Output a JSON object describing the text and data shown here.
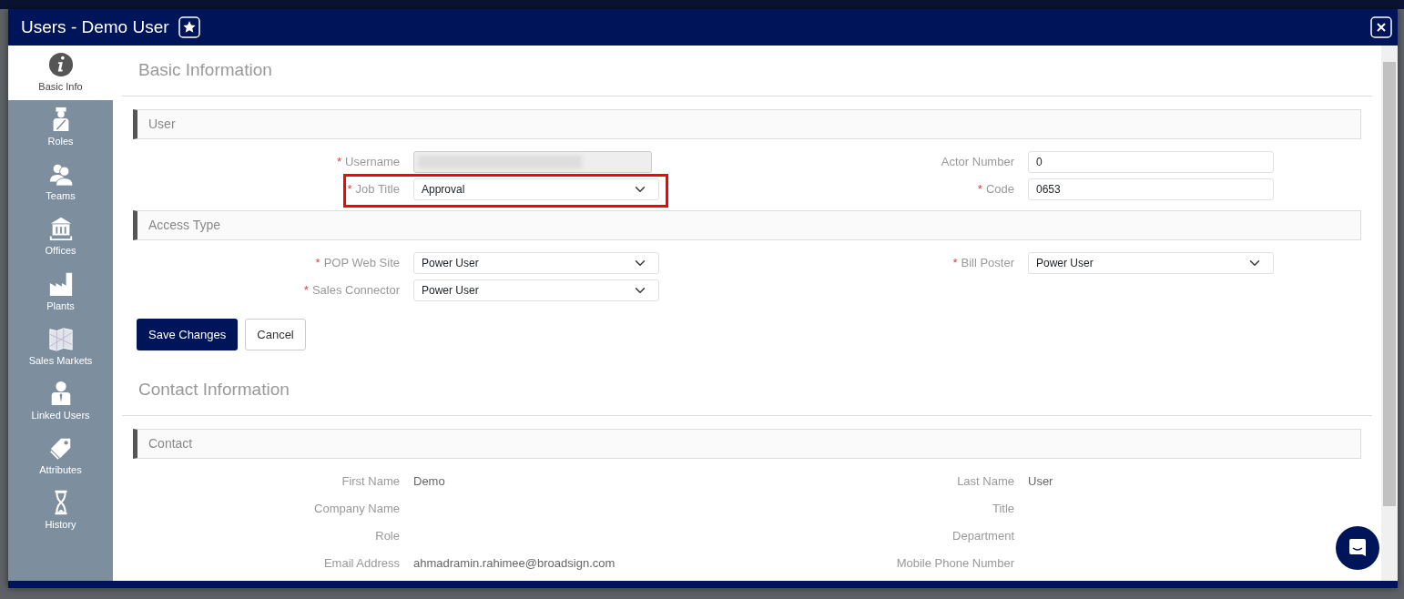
{
  "window": {
    "title": "Users - Demo User"
  },
  "sidebar": {
    "items": [
      {
        "label": "Basic Info",
        "selected": true
      },
      {
        "label": "Roles",
        "selected": false
      },
      {
        "label": "Teams",
        "selected": false
      },
      {
        "label": "Offices",
        "selected": false
      },
      {
        "label": "Plants",
        "selected": false
      },
      {
        "label": "Sales Markets",
        "selected": false
      },
      {
        "label": "Linked Users",
        "selected": false
      },
      {
        "label": "Attributes",
        "selected": false
      },
      {
        "label": "History",
        "selected": false
      }
    ]
  },
  "sections": [
    {
      "heading": "Basic Information",
      "groups": [
        {
          "title": "User",
          "left": [
            {
              "label": "Username",
              "marker": "*",
              "kind": "blurred"
            },
            {
              "label": "Job Title",
              "marker": "*",
              "kind": "select",
              "value": "Approval",
              "highlighted": true
            }
          ],
          "right": [
            {
              "label": "Actor Number",
              "kind": "input",
              "value": "0"
            },
            {
              "label": "Code",
              "marker": "*",
              "kind": "input",
              "value": "0653"
            }
          ]
        },
        {
          "title": "Access Type",
          "left": [
            {
              "label": "POP Web Site",
              "marker": "*",
              "kind": "select",
              "value": "Power User"
            },
            {
              "label": "Sales Connector",
              "marker": "*",
              "kind": "select",
              "value": "Power User"
            }
          ],
          "right": [
            {
              "label": "Bill Poster",
              "marker": "*",
              "kind": "select",
              "value": "Power User"
            }
          ]
        }
      ],
      "buttons": [
        {
          "label": "Save Changes",
          "kind": "primary"
        },
        {
          "label": "Cancel",
          "kind": "secondary"
        }
      ]
    },
    {
      "heading": "Contact Information",
      "groups": [
        {
          "title": "Contact",
          "left": [
            {
              "label": "First Name",
              "kind": "text",
              "value": "Demo"
            },
            {
              "label": "Company Name",
              "kind": "text"
            },
            {
              "label": "Role",
              "kind": "text"
            },
            {
              "label": "Email Address",
              "kind": "text",
              "value": "ahmadramin.rahimee@broadsign.com"
            }
          ],
          "right": [
            {
              "label": "Last Name",
              "kind": "text",
              "value": "User"
            },
            {
              "label": "Title",
              "kind": "text"
            },
            {
              "label": "Department",
              "kind": "text"
            },
            {
              "label": "Mobile Phone Number",
              "kind": "text"
            }
          ]
        }
      ]
    }
  ]
}
